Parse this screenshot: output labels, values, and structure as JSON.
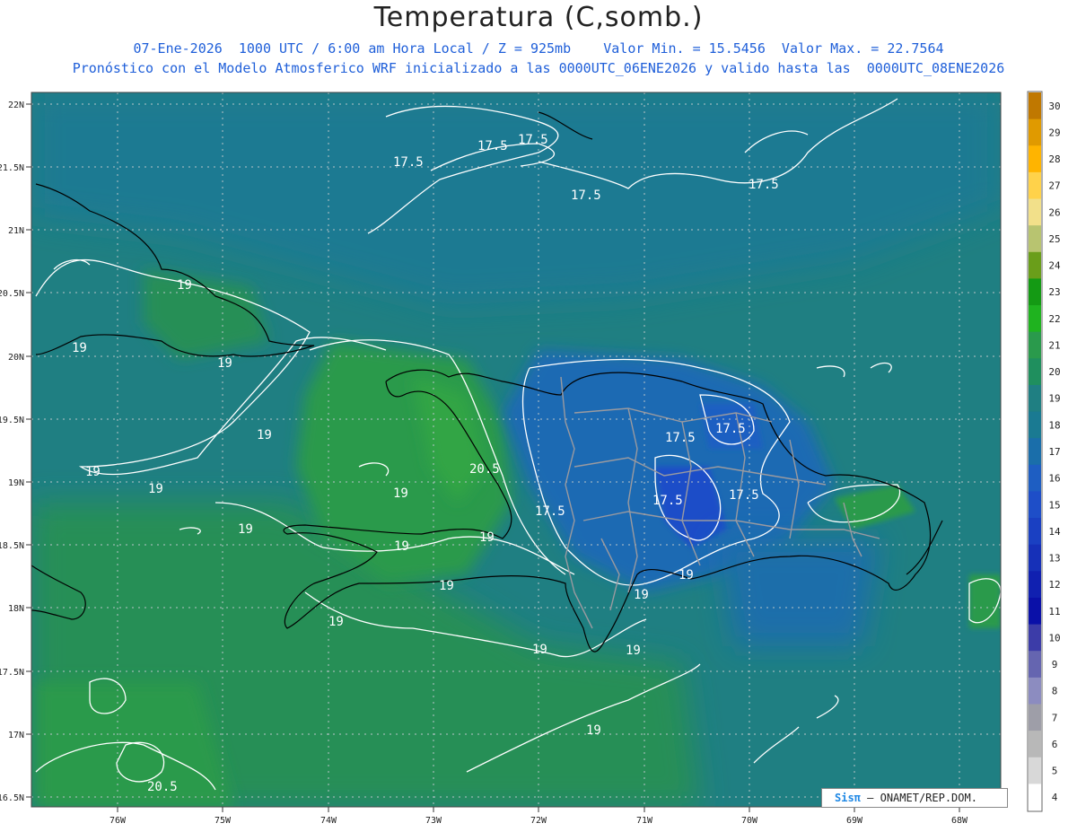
{
  "header": {
    "title": "Temperatura (C,somb.)",
    "line1": "07-Ene-2026  1000 UTC / 6:00 am Hora Local / Z = 925mb    Valor Min. = 15.5456  Valor Max. = 22.7564",
    "line2": "Pronóstico con el Modelo Atmosferico WRF inicializado a las 0000UTC_06ENE2026 y valido hasta las  0000UTC_08ENE2026"
  },
  "map": {
    "lat_labels": [
      "22N",
      "21.5N",
      "21N",
      "20.5N",
      "20N",
      "19.5N",
      "19N",
      "18.5N",
      "18N",
      "17.5N",
      "17N",
      "16.5N"
    ],
    "lon_labels": [
      "76W",
      "75W",
      "74W",
      "73W",
      "72W",
      "71W",
      "70W",
      "69W",
      "68W"
    ],
    "contour_labels": [
      "17.5",
      "17.5",
      "17.5",
      "17.5",
      "17.5",
      "19",
      "19",
      "19",
      "19",
      "19",
      "17.5",
      "17.5",
      "17.5",
      "17.5",
      "20.5",
      "19",
      "19",
      "19",
      "19",
      "19",
      "19",
      "19",
      "19",
      "19",
      "19",
      "20.5"
    ],
    "ocean_color": "#1f7f82",
    "land_color": "#2a9a4c",
    "cold_color": "#1e6ab3"
  },
  "colorbar": {
    "labels": [
      "30",
      "29",
      "28",
      "27",
      "26",
      "25",
      "24",
      "23",
      "22",
      "21",
      "20",
      "19",
      "18",
      "17",
      "16",
      "15",
      "14",
      "13",
      "12",
      "11",
      "10",
      "9",
      "8",
      "7",
      "6",
      "5",
      "4"
    ],
    "colors": [
      "#c07800",
      "#e09a00",
      "#ffb400",
      "#ffd24a",
      "#f2e08a",
      "#b8c470",
      "#6a9e1a",
      "#149a14",
      "#1fb31f",
      "#2a9a4c",
      "#1f8f5e",
      "#1f7f82",
      "#1a7a92",
      "#1a6eaa",
      "#1e5ec2",
      "#1e4ec8",
      "#1a40c2",
      "#1630b8",
      "#1020b0",
      "#0a10a8",
      "#3c3ca8",
      "#6565b0",
      "#8c8cc0",
      "#9e9ea8",
      "#b8b8b8",
      "#d8d8d8",
      "#ffffff"
    ]
  },
  "credit": {
    "logo": "Sisπ",
    "text": "– ONAMET/REP.DOM."
  }
}
